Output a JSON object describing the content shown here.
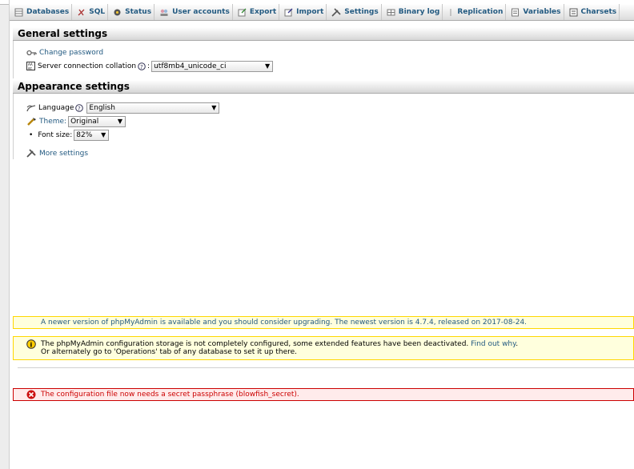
{
  "tabs": [
    {
      "label": "Databases",
      "icon": "database-icon"
    },
    {
      "label": "SQL",
      "icon": "sql-icon"
    },
    {
      "label": "Status",
      "icon": "status-icon"
    },
    {
      "label": "User accounts",
      "icon": "users-icon"
    },
    {
      "label": "Export",
      "icon": "export-icon"
    },
    {
      "label": "Import",
      "icon": "import-icon"
    },
    {
      "label": "Settings",
      "icon": "settings-icon"
    },
    {
      "label": "Binary log",
      "icon": "binlog-icon"
    },
    {
      "label": "Replication",
      "icon": "replication-icon"
    },
    {
      "label": "Variables",
      "icon": "variables-icon"
    },
    {
      "label": "Charsets",
      "icon": "charsets-icon"
    }
  ],
  "general": {
    "title": "General settings",
    "change_password": "Change password",
    "collation_label": "Server connection collation",
    "collation_value": "utf8mb4_unicode_ci"
  },
  "appearance": {
    "title": "Appearance settings",
    "language_label": "Language",
    "language_value": "English",
    "theme_label": "Theme:",
    "theme_value": "Original",
    "fontsize_label": "Font size:",
    "fontsize_value": "82%",
    "more_settings": "More settings"
  },
  "notices": {
    "upgrade": "A newer version of phpMyAdmin is available and you should consider upgrading. The newest version is 4.7.4, released on 2017-08-24.",
    "storage_line1": "The phpMyAdmin configuration storage is not completely configured, some extended features have been deactivated.",
    "storage_link": "Find out why",
    "storage_dot": ".",
    "storage_line2": "Or alternately go to 'Operations' tab of any database to set it up there.",
    "error": "The configuration file now needs a secret passphrase (blowfish_secret)."
  },
  "colors": {
    "link": "#235a81",
    "notice_bg": "#ffffdd",
    "notice_border": "#ffd700",
    "error_bg": "#ffebeb",
    "error_border": "#cc0000"
  }
}
